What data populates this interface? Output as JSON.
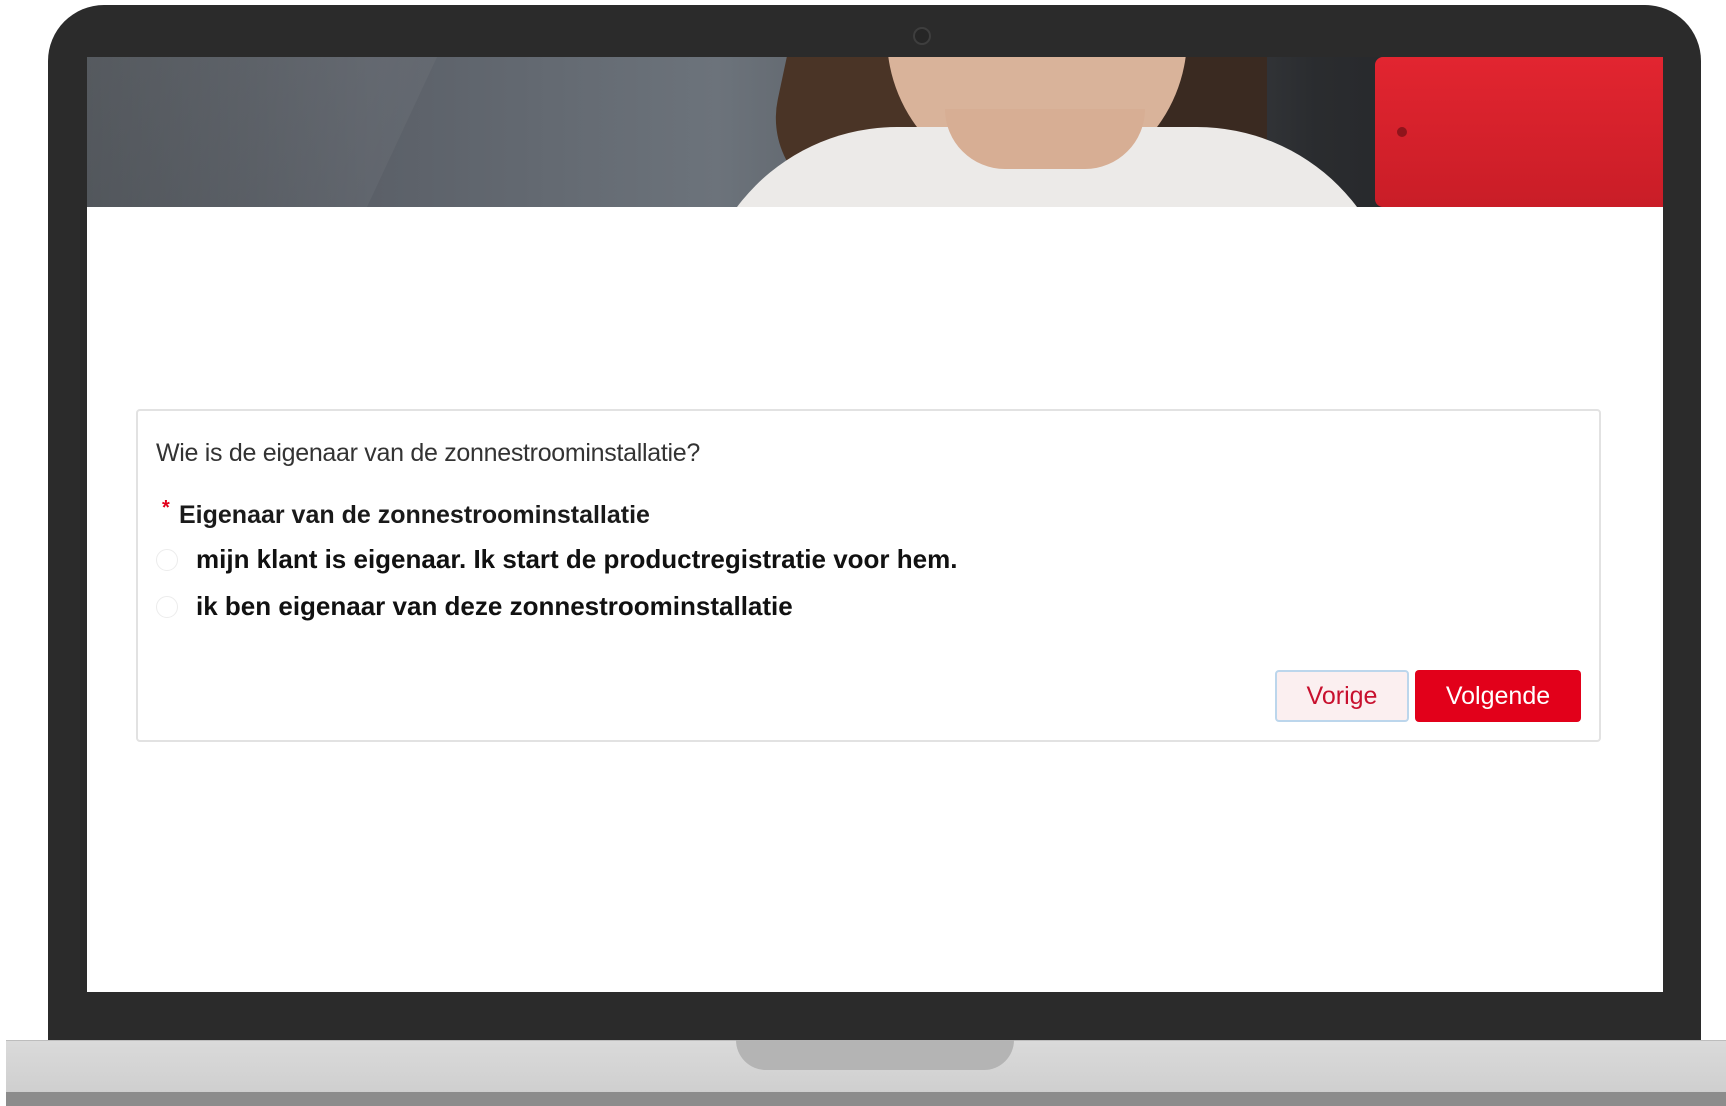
{
  "form": {
    "question": "Wie is de eigenaar van de zonnestroominstallatie?",
    "field_label": "Eigenaar van de zonnestroominstallatie",
    "required_marker": "*",
    "options": [
      {
        "label": "mijn klant is eigenaar. Ik start de productregistratie voor hem.",
        "selected": false
      },
      {
        "label": "ik ben eigenaar van deze zonnestroominstallatie",
        "selected": false
      }
    ],
    "buttons": {
      "previous": "Vorige",
      "next": "Volgende"
    }
  },
  "colors": {
    "brand_red": "#e2001a",
    "frame": "#2b2b2b"
  }
}
